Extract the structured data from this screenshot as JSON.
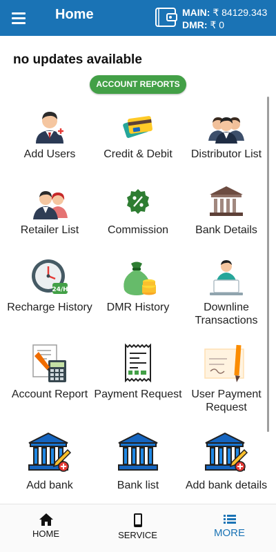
{
  "header": {
    "title": "Home",
    "main_label": "MAIN:",
    "main_value": "₹ 84129.343",
    "dmr_label": "DMR:",
    "dmr_value": "₹ 0"
  },
  "updates_text": "no updates available",
  "section_badge": "ACCOUNT REPORTS",
  "tiles": [
    {
      "label": "Add Users",
      "icon": "add-user-icon"
    },
    {
      "label": "Credit & Debit",
      "icon": "credit-cards-icon"
    },
    {
      "label": "Distributor List",
      "icon": "group-icon"
    },
    {
      "label": "Retailer List",
      "icon": "people-icon"
    },
    {
      "label": "Commission",
      "icon": "percent-badge-icon"
    },
    {
      "label": "Bank Details",
      "icon": "bank-icon"
    },
    {
      "label": "Recharge History",
      "icon": "clock-24h-icon"
    },
    {
      "label": "DMR History",
      "icon": "money-bag-icon"
    },
    {
      "label": "Downline Transactions",
      "icon": "person-laptop-icon"
    },
    {
      "label": "Account Report",
      "icon": "report-calculator-icon"
    },
    {
      "label": "Payment Request",
      "icon": "receipt-icon"
    },
    {
      "label": "User Payment Request",
      "icon": "cheque-pencil-icon"
    },
    {
      "label": "Add bank",
      "icon": "bank-edit-icon"
    },
    {
      "label": "Bank list",
      "icon": "bank-building-icon"
    },
    {
      "label": "Add bank details",
      "icon": "bank-edit-icon"
    }
  ],
  "nav": [
    {
      "label": "HOME",
      "icon": "home-icon"
    },
    {
      "label": "SERVICE",
      "icon": "phone-icon"
    },
    {
      "label": "MORE",
      "icon": "list-icon",
      "active": true
    }
  ],
  "colors": {
    "primary": "#1a73b5",
    "badge": "#43a047"
  }
}
